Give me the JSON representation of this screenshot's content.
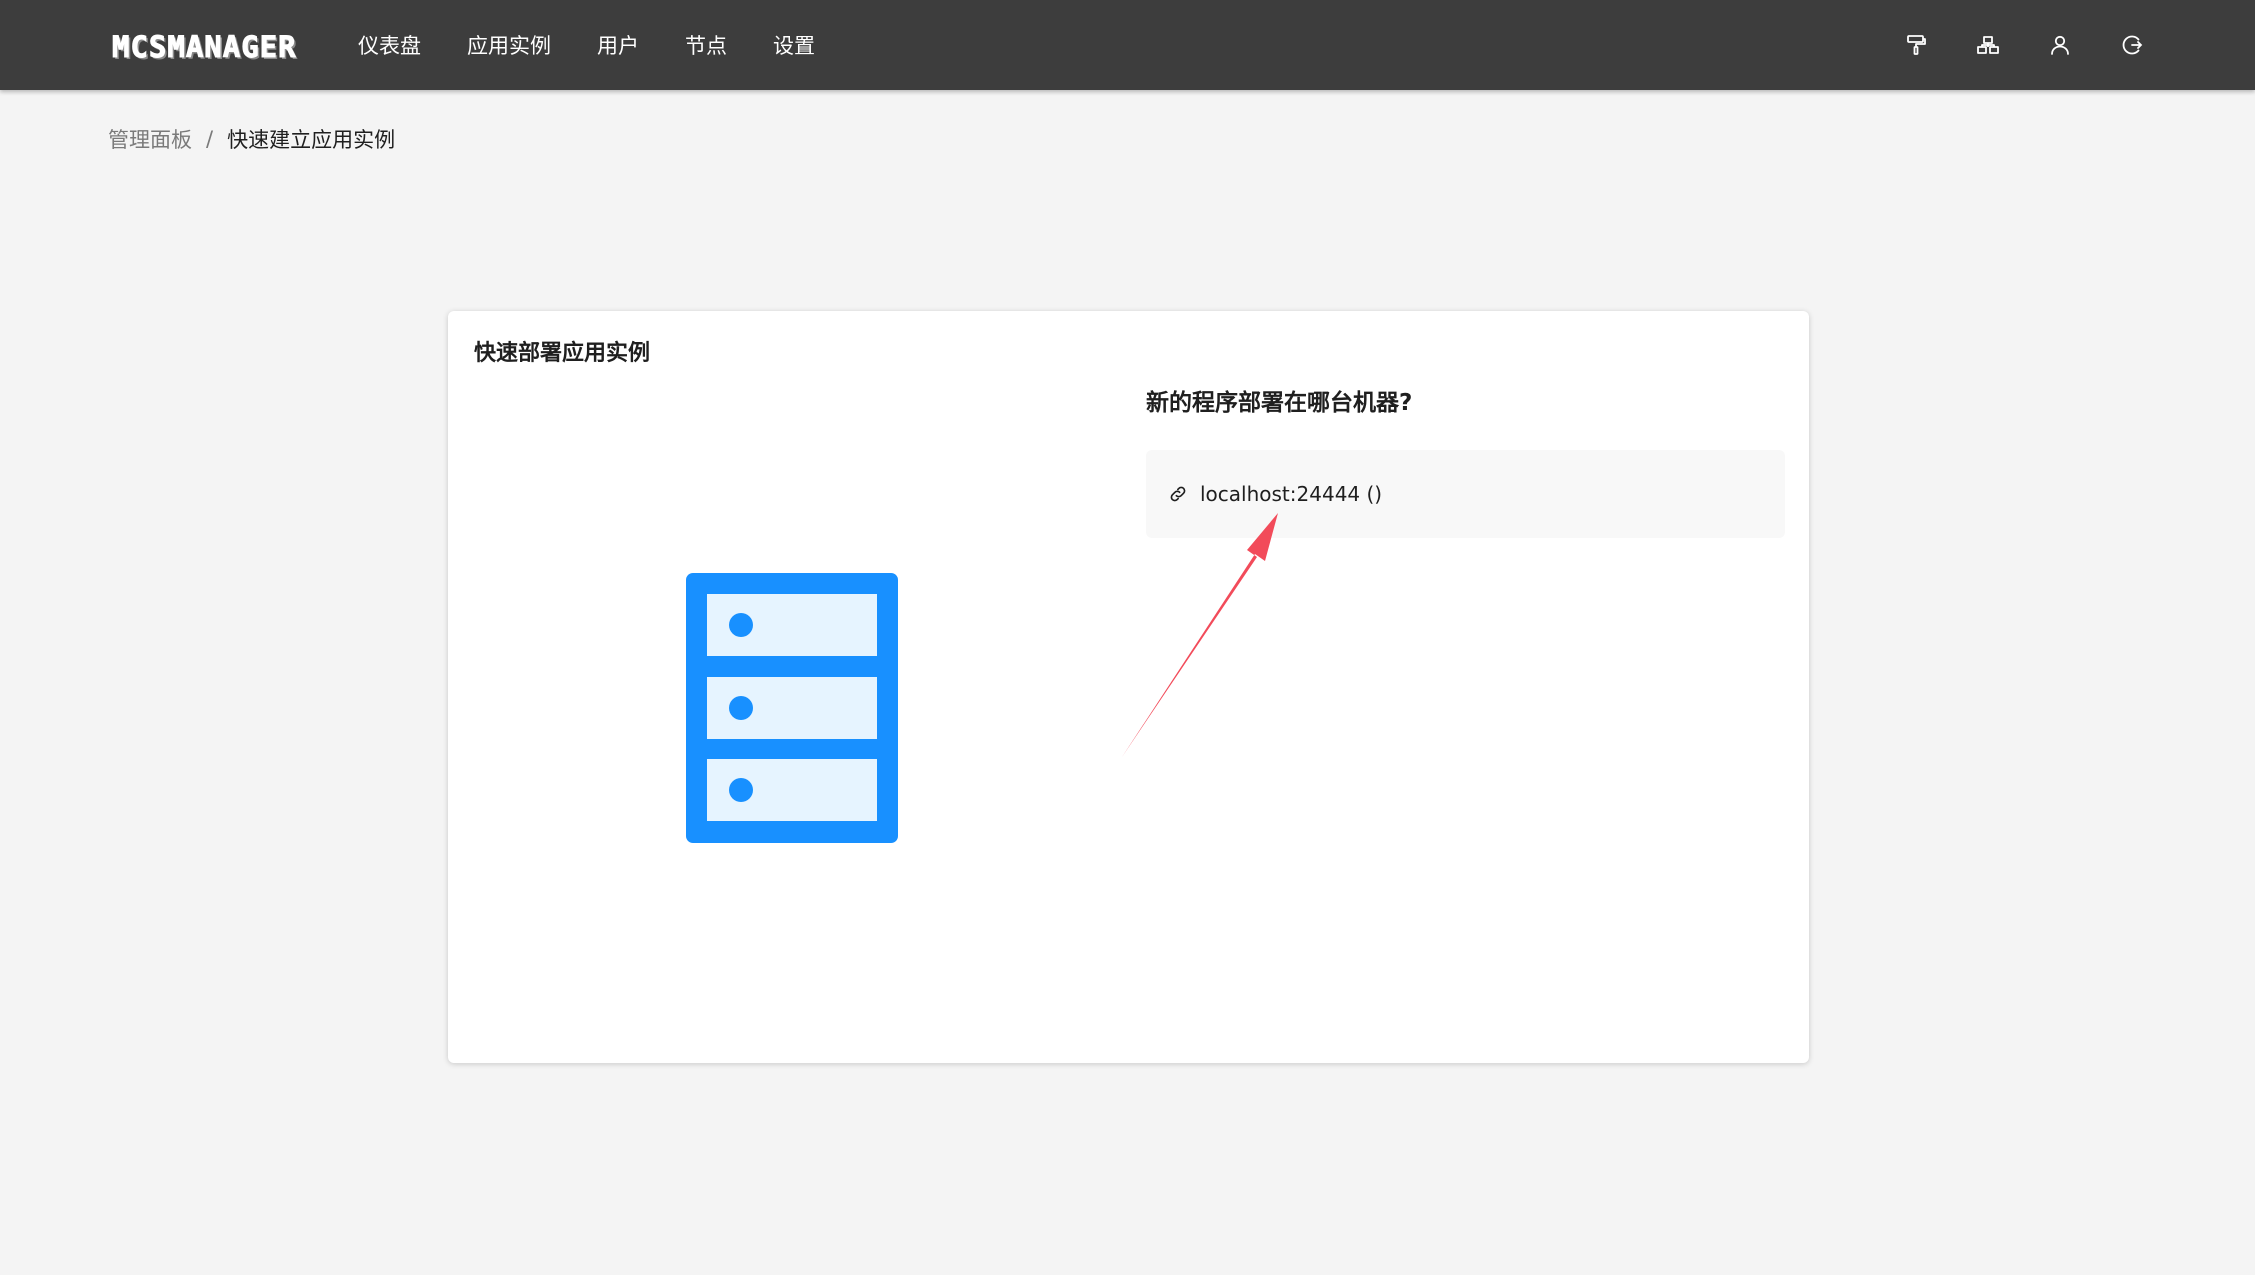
{
  "topbar": {
    "logo_text": "MCSMANAGER",
    "nav_items": [
      "仪表盘",
      "应用实例",
      "用户",
      "节点",
      "设置"
    ],
    "icons": [
      "paint-roller-icon",
      "network-icon",
      "user-icon",
      "logout-icon"
    ]
  },
  "breadcrumb": {
    "root": "管理面板",
    "separator": "/",
    "current": "快速建立应用实例"
  },
  "card": {
    "title": "快速部署应用实例",
    "question": "新的程序部署在哪台机器?",
    "node_option": {
      "label": "localhost:24444 ()",
      "icon": "link-icon"
    },
    "illustration": "server-rack-icon"
  },
  "colors": {
    "topbar_bg": "#3d3d3d",
    "page_bg": "#f4f4f4",
    "server_blue": "#1890ff",
    "server_slot_fill": "#e6f4ff",
    "annotation_arrow": "#f24b5a"
  }
}
